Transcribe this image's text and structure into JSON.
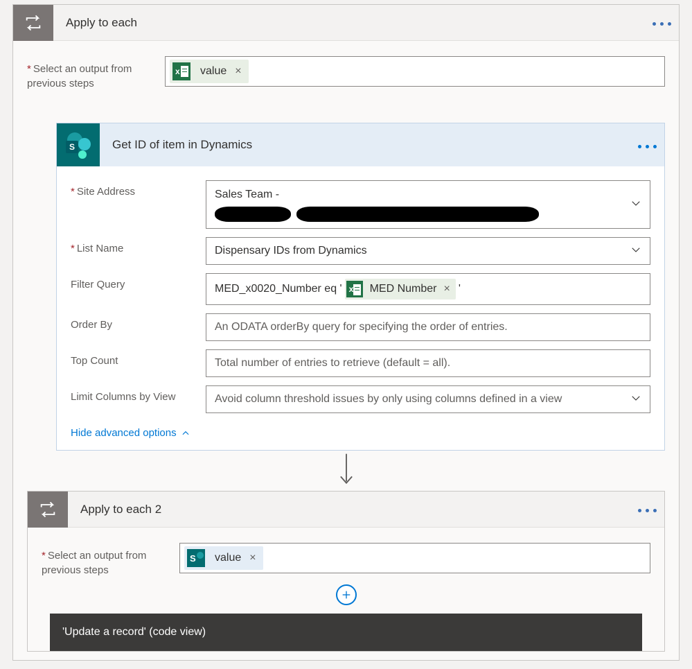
{
  "loop1": {
    "title": "Apply to each",
    "select_label": "Select an output from previous steps",
    "token": {
      "label": "value"
    }
  },
  "sharepoint_action": {
    "title": "Get ID of item in Dynamics",
    "fields": {
      "site_address": {
        "label": "Site Address",
        "value_line1": "Sales Team -"
      },
      "list_name": {
        "label": "List Name",
        "value": "Dispensary IDs from Dynamics"
      },
      "filter_query": {
        "label": "Filter Query",
        "prefix": "MED_x0020_Number eq '",
        "token": "MED Number",
        "suffix": "'"
      },
      "order_by": {
        "label": "Order By",
        "placeholder": "An ODATA orderBy query for specifying the order of entries."
      },
      "top_count": {
        "label": "Top Count",
        "placeholder": "Total number of entries to retrieve (default = all)."
      },
      "limit_cols": {
        "label": "Limit Columns by View",
        "placeholder": "Avoid column threshold issues by only using columns defined in a view"
      }
    },
    "adv_link": "Hide advanced options"
  },
  "loop2": {
    "title": "Apply to each 2",
    "select_label": "Select an output from previous steps",
    "token": {
      "label": "value"
    },
    "code_view_title": "'Update a record' (code view)"
  }
}
